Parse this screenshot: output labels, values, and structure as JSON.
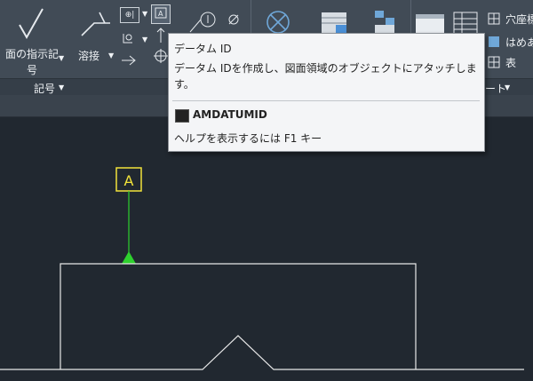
{
  "ribbon": {
    "surface_finish_label_line1": "面の指示記",
    "surface_finish_label_line2": "号",
    "welding_label": "溶接",
    "hole_label": "穴座標",
    "fit_label": "はめあ",
    "table_label": "表",
    "panels": {
      "symbols": "記号",
      "table_panel_suffix": "ート"
    }
  },
  "tooltip": {
    "title": "データム ID",
    "description": "データム IDを作成し、図面領域のオブジェクトにアタッチします。",
    "command": "AMDATUMID",
    "help": "ヘルプを表示するには F1 キー"
  },
  "canvas": {
    "datum_letter": "A"
  },
  "colors": {
    "canvas_bg": "#212830",
    "ribbon_bg": "#414b56",
    "datum_box": "#f2e33a",
    "leader": "#2ed12e",
    "geometry": "#e8e8e8"
  },
  "icons": [
    "surface-finish-icon",
    "welding-icon",
    "datum-target-icon",
    "datum-id-icon",
    "feature-control-icon",
    "taper-icon",
    "hole-chart-icon",
    "table-icon"
  ]
}
